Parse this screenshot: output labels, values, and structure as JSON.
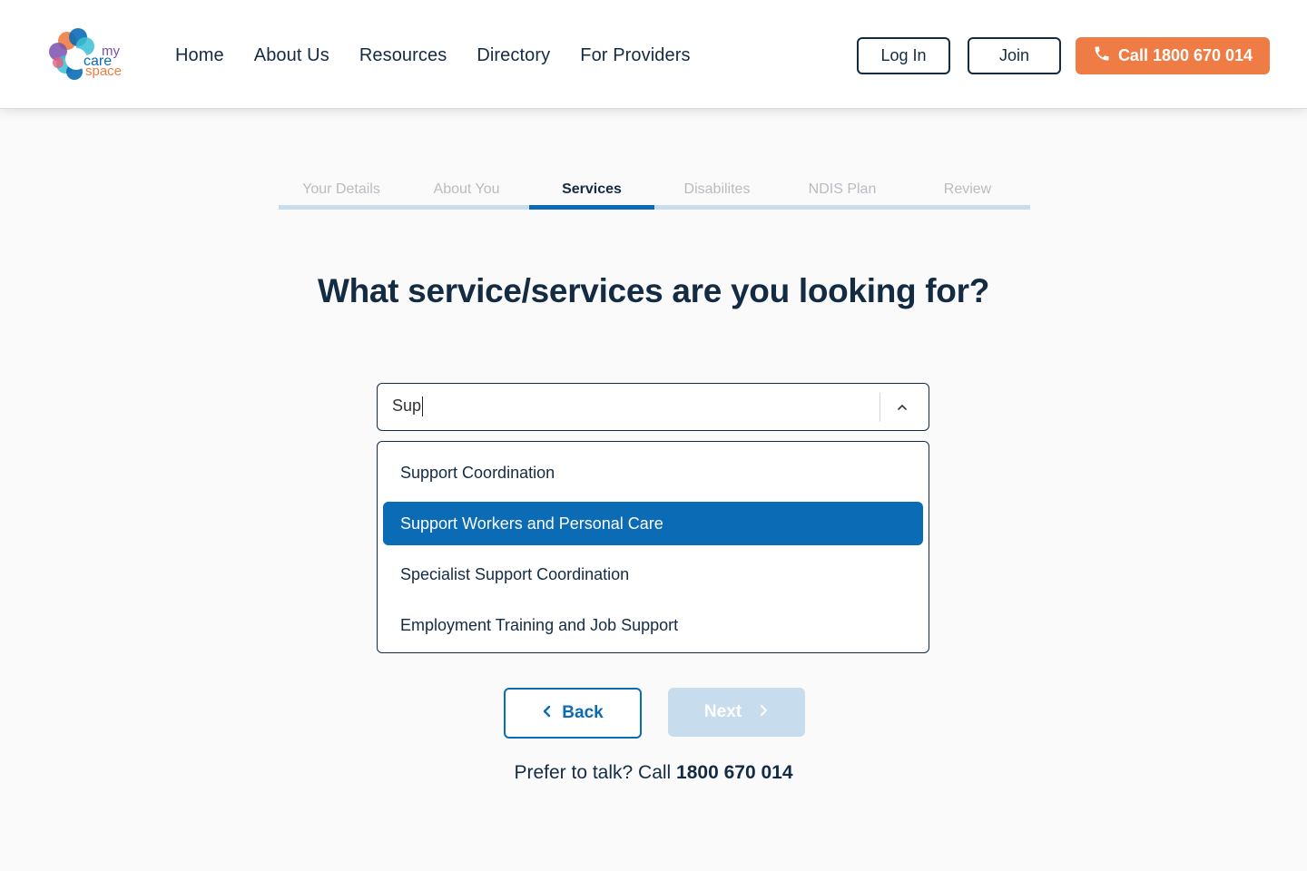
{
  "brand": {
    "logo_text_1": "my",
    "logo_text_2": "care",
    "logo_text_3": "space"
  },
  "nav": {
    "items": [
      {
        "label": "Home"
      },
      {
        "label": "About Us"
      },
      {
        "label": "Resources"
      },
      {
        "label": "Directory"
      },
      {
        "label": "For Providers"
      }
    ]
  },
  "header_actions": {
    "login_label": "Log In",
    "join_label": "Join",
    "call_label": "Call 1800 670 014",
    "call_icon": "phone-icon"
  },
  "stepper": {
    "steps": [
      {
        "label": "Your Details"
      },
      {
        "label": "About You"
      },
      {
        "label": "Services"
      },
      {
        "label": "Disabilites"
      },
      {
        "label": "NDIS Plan"
      },
      {
        "label": "Review"
      }
    ],
    "active_index": 2
  },
  "question": "What service/services are you looking for?",
  "service_select": {
    "value": "Sup",
    "options": [
      {
        "label": "Support Coordination"
      },
      {
        "label": "Support Workers and Personal Care"
      },
      {
        "label": "Specialist Support Coordination"
      },
      {
        "label": "Employment Training and Job Support"
      }
    ],
    "highlighted_index": 1
  },
  "actions": {
    "back_label": "Back",
    "next_label": "Next"
  },
  "footer": {
    "prefer_text": "Prefer to talk? Call ",
    "phone": "1800 670 014"
  },
  "colors": {
    "primary": "#0b6bb5",
    "accent": "#f07c45",
    "navy": "#142b44",
    "disabled": "#c7dced"
  }
}
